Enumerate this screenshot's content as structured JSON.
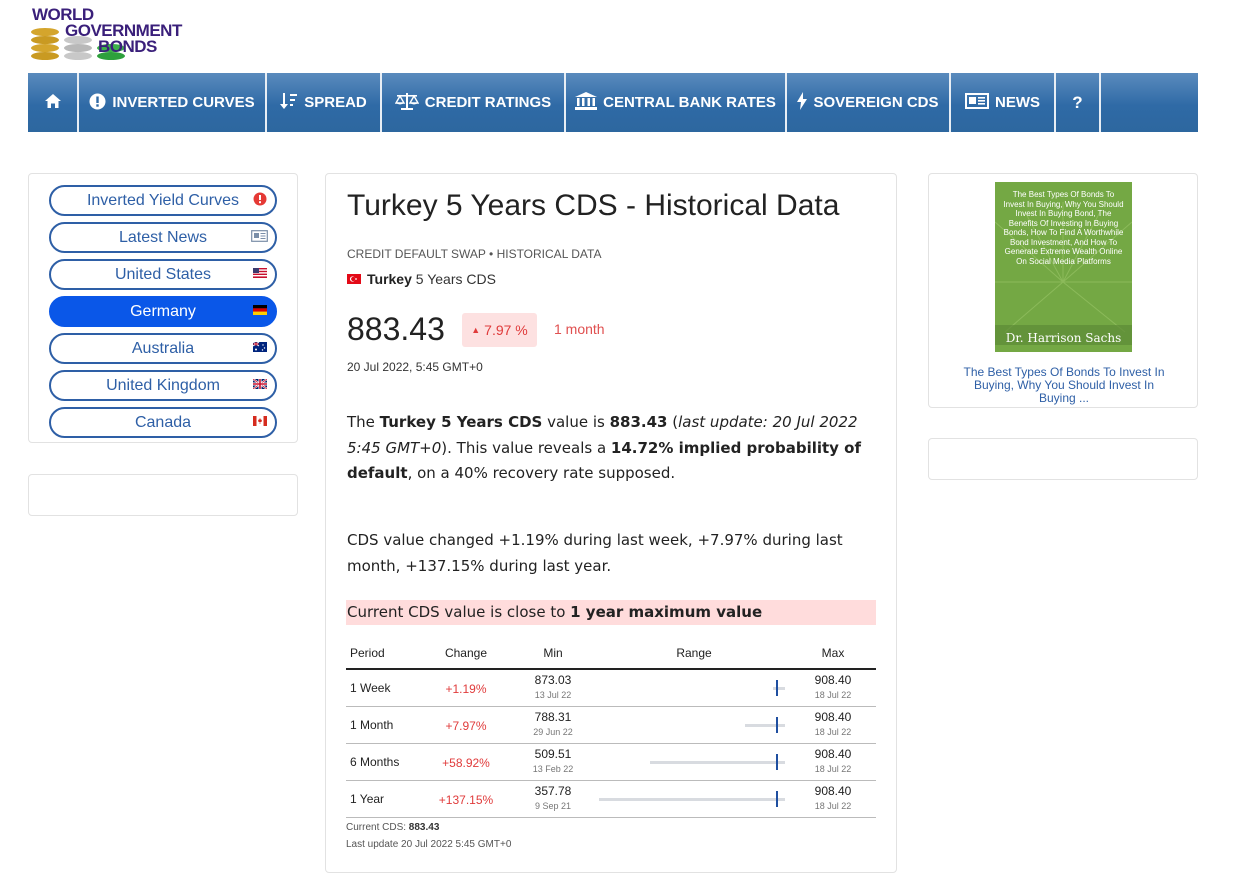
{
  "logo": {
    "line1": "WORLD",
    "line2": "GOVERNMENT",
    "line3": "BONDS"
  },
  "nav": [
    {
      "icon": "home-icon",
      "label": ""
    },
    {
      "icon": "exclamation-circle-icon",
      "label": "INVERTED CURVES"
    },
    {
      "icon": "sort-icon",
      "label": "SPREAD"
    },
    {
      "icon": "balance-scale-icon",
      "label": "CREDIT RATINGS"
    },
    {
      "icon": "bank-icon",
      "label": "CENTRAL BANK RATES"
    },
    {
      "icon": "bolt-icon",
      "label": "SOVEREIGN CDS"
    },
    {
      "icon": "newspaper-icon",
      "label": "NEWS"
    },
    {
      "icon": "question-icon",
      "label": "?"
    }
  ],
  "sidebar": {
    "items": [
      {
        "label": "Inverted Yield Curves",
        "icon": "exclamation-circle-icon",
        "active": false
      },
      {
        "label": "Latest News",
        "icon": "newspaper-icon",
        "active": false
      },
      {
        "label": "United States",
        "icon": "us-flag-icon",
        "active": false
      },
      {
        "label": "Germany",
        "icon": "germany-flag-icon",
        "active": true
      },
      {
        "label": "Australia",
        "icon": "australia-flag-icon",
        "active": false
      },
      {
        "label": "United Kingdom",
        "icon": "uk-flag-icon",
        "active": false
      },
      {
        "label": "Canada",
        "icon": "canada-flag-icon",
        "active": false
      }
    ]
  },
  "main": {
    "title": "Turkey 5 Years CDS - Historical Data",
    "subtitle": "CREDIT DEFAULT SWAP • HISTORICAL DATA",
    "instrument_country": "Turkey",
    "instrument_name": "5 Years CDS",
    "value": "883.43",
    "change": "7.97 %",
    "change_period": "1 month",
    "date": "20 Jul 2022, 5:45 GMT+0",
    "para1": {
      "t1": "The ",
      "b1": "Turkey 5 Years CDS",
      "t2": " value is ",
      "b2": "883.43",
      "t3": " (",
      "i1": "last update: 20 Jul 2022 5:45 GMT+0",
      "t4": "). This value reveals a ",
      "b3": "14.72% implied probability of default",
      "t5": ", on a 40% recovery rate supposed."
    },
    "para2": "CDS value changed +1.19% during last week, +7.97% during last month, +137.15% during last year.",
    "alert": {
      "text": "Current CDS value is close to ",
      "bold": "1 year maximum value"
    },
    "table": {
      "headers": [
        "Period",
        "Change",
        "Min",
        "Range",
        "Max"
      ],
      "rows": [
        {
          "period": "1 Week",
          "change": "+1.19%",
          "min": "873.03",
          "min_date": "13 Jul 22",
          "max": "908.40",
          "max_date": "18 Jul 22",
          "range_min": 873.03,
          "range_max": 908.4,
          "current": 883.43
        },
        {
          "period": "1 Month",
          "change": "+7.97%",
          "min": "788.31",
          "min_date": "29 Jun 22",
          "max": "908.40",
          "max_date": "18 Jul 22",
          "range_min": 788.31,
          "range_max": 908.4,
          "current": 883.43
        },
        {
          "period": "6 Months",
          "change": "+58.92%",
          "min": "509.51",
          "min_date": "13 Feb 22",
          "max": "908.40",
          "max_date": "18 Jul 22",
          "range_min": 509.51,
          "range_max": 908.4,
          "current": 883.43
        },
        {
          "period": "1 Year",
          "change": "+137.15%",
          "min": "357.78",
          "min_date": "9 Sep 21",
          "max": "908.40",
          "max_date": "18 Jul 22",
          "range_min": 357.78,
          "range_max": 908.4,
          "current": 883.43
        }
      ]
    },
    "footer": {
      "current_label": "Current CDS: ",
      "current_value": "883.43",
      "update": "Last update 20 Jul 2022 5:45 GMT+0"
    }
  },
  "right": {
    "book_title": "The Best Types Of Bonds To Invest In Buying, Why You Should Invest In Buying Bond, The Benefits Of Investing In Buying Bonds, How To Find A Worthwhile Bond Investment, And How To Generate Extreme Wealth Online On Social Media Platforms",
    "book_author": "Dr. Harrison Sachs",
    "book_link": "The Best Types Of Bonds To Invest In Buying, Why You Should Invest In Buying ..."
  },
  "colors": {
    "nav": "#2f6aa6",
    "accent": "#0a57e8",
    "negative": "#e03b3b",
    "alert_bg": "#ffdcdc"
  }
}
